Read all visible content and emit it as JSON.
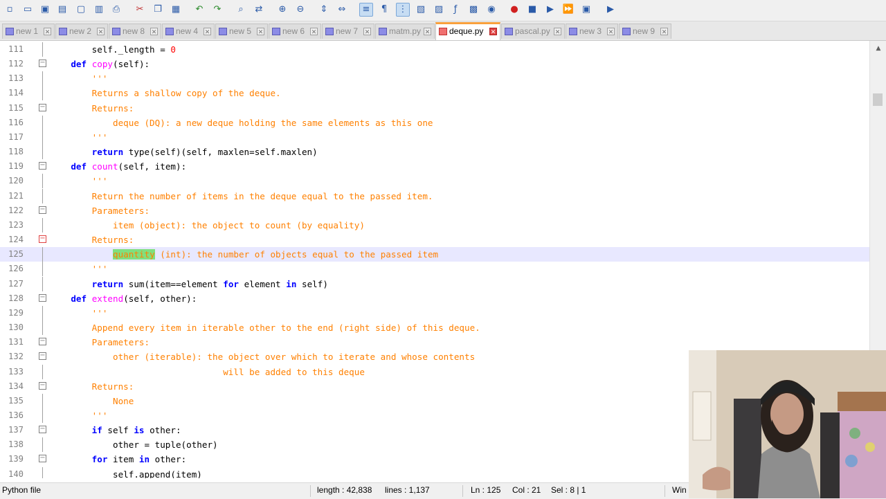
{
  "toolbar": {
    "buttons": [
      "new-icon",
      "open-icon",
      "save-icon",
      "save-all-icon",
      "close-icon",
      "close-all-icon",
      "print-icon",
      "cut-icon",
      "copy-icon",
      "paste-icon",
      "undo-icon",
      "redo-icon",
      "find-icon",
      "replace-icon",
      "zoom-in-icon",
      "zoom-out-icon",
      "sync-v-icon",
      "sync-h-icon",
      "word-wrap-icon",
      "show-all-chars-icon",
      "indent-guide-icon",
      "udl-icon",
      "doc-map-icon",
      "function-list-icon",
      "folder-workspace-icon",
      "monitor-icon",
      "record-macro-icon",
      "stop-macro-icon",
      "play-macro-icon",
      "run-macro-multiple-icon",
      "save-macro-icon",
      "run-icon"
    ]
  },
  "tabs": [
    {
      "label": "new 1",
      "icon": "blue",
      "active": false
    },
    {
      "label": "new 2",
      "icon": "blue",
      "active": false
    },
    {
      "label": "new 8",
      "icon": "blue",
      "active": false
    },
    {
      "label": "new 4",
      "icon": "blue",
      "active": false
    },
    {
      "label": "new 5",
      "icon": "blue",
      "active": false
    },
    {
      "label": "new 6",
      "icon": "blue",
      "active": false
    },
    {
      "label": "new 7",
      "icon": "blue",
      "active": false
    },
    {
      "label": "matm.py",
      "icon": "blue",
      "active": false
    },
    {
      "label": "deque.py",
      "icon": "red",
      "active": true
    },
    {
      "label": "pascal.py",
      "icon": "blue",
      "active": false
    },
    {
      "label": "new 3",
      "icon": "blue",
      "active": false
    },
    {
      "label": "new 9",
      "icon": "blue",
      "active": false
    }
  ],
  "editor": {
    "current_line": "125",
    "lines": [
      {
        "n": "111",
        "fold": "",
        "tokens": [
          [
            "        self._length = ",
            ""
          ],
          [
            "0",
            "num"
          ]
        ]
      },
      {
        "n": "112",
        "fold": "minus",
        "tokens": [
          [
            "    ",
            ""
          ],
          [
            "def",
            "kw"
          ],
          [
            " ",
            ""
          ],
          [
            "copy",
            "fn"
          ],
          [
            "(self):",
            ""
          ]
        ]
      },
      {
        "n": "113",
        "fold": "",
        "tokens": [
          [
            "        '''",
            "ds"
          ]
        ]
      },
      {
        "n": "114",
        "fold": "",
        "tokens": [
          [
            "        Returns a shallow copy of the deque.",
            "ds"
          ]
        ]
      },
      {
        "n": "115",
        "fold": "minus",
        "tokens": [
          [
            "        Returns:",
            "ds"
          ]
        ]
      },
      {
        "n": "116",
        "fold": "",
        "tokens": [
          [
            "            deque (DQ): a new deque holding the same elements as this one",
            "ds"
          ]
        ]
      },
      {
        "n": "117",
        "fold": "",
        "tokens": [
          [
            "        '''",
            "ds"
          ]
        ]
      },
      {
        "n": "118",
        "fold": "",
        "tokens": [
          [
            "        ",
            ""
          ],
          [
            "return",
            "kw"
          ],
          [
            " type(self)(self, maxlen=self.maxlen)",
            ""
          ]
        ]
      },
      {
        "n": "119",
        "fold": "minus",
        "tokens": [
          [
            "    ",
            ""
          ],
          [
            "def",
            "kw"
          ],
          [
            " ",
            ""
          ],
          [
            "count",
            "fn"
          ],
          [
            "(self, item):",
            ""
          ]
        ]
      },
      {
        "n": "120",
        "fold": "",
        "tokens": [
          [
            "        '''",
            "ds"
          ]
        ]
      },
      {
        "n": "121",
        "fold": "",
        "tokens": [
          [
            "        Return the number of items in the deque equal to the passed item.",
            "ds"
          ]
        ]
      },
      {
        "n": "122",
        "fold": "minus",
        "tokens": [
          [
            "        Parameters:",
            "ds"
          ]
        ]
      },
      {
        "n": "123",
        "fold": "",
        "tokens": [
          [
            "            item (object): the object to count (by equality)",
            "ds"
          ]
        ]
      },
      {
        "n": "124",
        "fold": "minus-red",
        "tokens": [
          [
            "        Returns:",
            "ds"
          ]
        ]
      },
      {
        "n": "125",
        "fold": "",
        "tokens": [
          [
            "            ",
            ""
          ],
          [
            "quantity",
            "hl"
          ],
          [
            " (int): the number of objects equal to the passed item",
            "ds"
          ]
        ]
      },
      {
        "n": "126",
        "fold": "",
        "tokens": [
          [
            "        '''",
            "ds"
          ]
        ]
      },
      {
        "n": "127",
        "fold": "",
        "tokens": [
          [
            "        ",
            ""
          ],
          [
            "return",
            "kw"
          ],
          [
            " sum(item==element ",
            ""
          ],
          [
            "for",
            "kw"
          ],
          [
            " element ",
            ""
          ],
          [
            "in",
            "kw"
          ],
          [
            " self)",
            ""
          ]
        ]
      },
      {
        "n": "128",
        "fold": "minus",
        "tokens": [
          [
            "    ",
            ""
          ],
          [
            "def",
            "kw"
          ],
          [
            " ",
            ""
          ],
          [
            "extend",
            "fn"
          ],
          [
            "(self, other):",
            ""
          ]
        ]
      },
      {
        "n": "129",
        "fold": "",
        "tokens": [
          [
            "        '''",
            "ds"
          ]
        ]
      },
      {
        "n": "130",
        "fold": "",
        "tokens": [
          [
            "        Append every item in iterable other to the end (right side) of this deque.",
            "ds"
          ]
        ]
      },
      {
        "n": "131",
        "fold": "minus",
        "tokens": [
          [
            "        Parameters:",
            "ds"
          ]
        ]
      },
      {
        "n": "132",
        "fold": "minus",
        "tokens": [
          [
            "            other (iterable): the object over which to iterate and whose contents",
            "ds"
          ]
        ]
      },
      {
        "n": "133",
        "fold": "",
        "tokens": [
          [
            "                                 will be added to this deque",
            "ds"
          ]
        ]
      },
      {
        "n": "134",
        "fold": "minus",
        "tokens": [
          [
            "        Returns:",
            "ds"
          ]
        ]
      },
      {
        "n": "135",
        "fold": "",
        "tokens": [
          [
            "            None",
            "ds"
          ]
        ]
      },
      {
        "n": "136",
        "fold": "",
        "tokens": [
          [
            "        '''",
            "ds"
          ]
        ]
      },
      {
        "n": "137",
        "fold": "minus",
        "tokens": [
          [
            "        ",
            ""
          ],
          [
            "if",
            "kw"
          ],
          [
            " self ",
            ""
          ],
          [
            "is",
            "kw"
          ],
          [
            " other:",
            ""
          ]
        ]
      },
      {
        "n": "138",
        "fold": "",
        "tokens": [
          [
            "            other = tuple(other)",
            ""
          ]
        ]
      },
      {
        "n": "139",
        "fold": "minus",
        "tokens": [
          [
            "        ",
            ""
          ],
          [
            "for",
            "kw"
          ],
          [
            " item ",
            ""
          ],
          [
            "in",
            "kw"
          ],
          [
            " other:",
            ""
          ]
        ]
      },
      {
        "n": "140",
        "fold": "",
        "tokens": [
          [
            "            self.append(item)",
            ""
          ]
        ]
      }
    ]
  },
  "status": {
    "filetype": "Python file",
    "length": "length : 42,838",
    "lines": "lines : 1,137",
    "ln": "Ln : 125",
    "col": "Col : 21",
    "sel": "Sel : 8 | 1",
    "eol": "Win"
  },
  "colors": {
    "keyword": "#0000ff",
    "function": "#ff00ff",
    "number": "#ff0000",
    "docstring": "#ff8000",
    "highlight": "#7fe07f",
    "current_line": "#e8e8ff",
    "active_tab_accent": "#f9a03c"
  }
}
